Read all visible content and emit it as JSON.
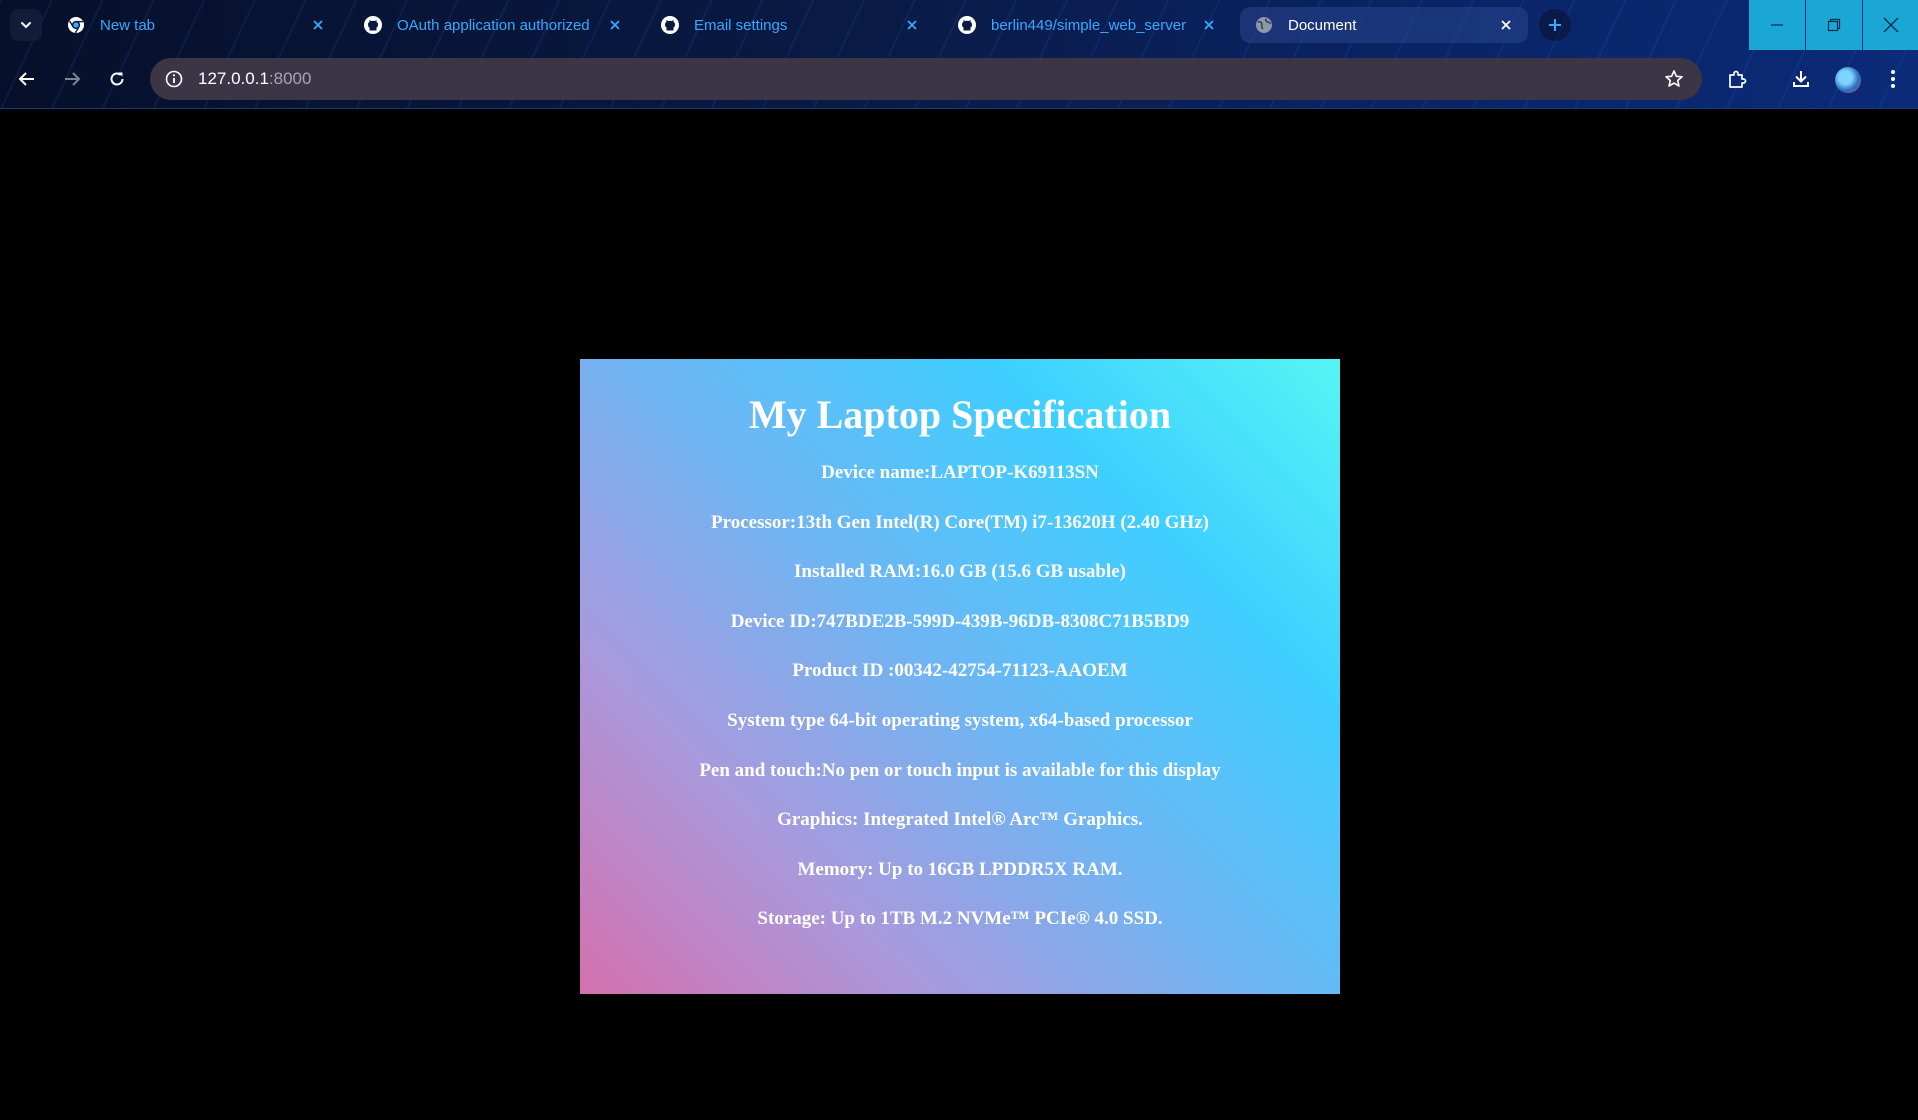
{
  "browser": {
    "tabs": [
      {
        "title": "New tab",
        "icon": "chrome-icon",
        "active": false
      },
      {
        "title": "OAuth application authorized",
        "icon": "github-icon",
        "active": false
      },
      {
        "title": "Email settings",
        "icon": "github-icon",
        "active": false
      },
      {
        "title": "berlin449/simple_web_server",
        "icon": "github-icon",
        "active": false
      },
      {
        "title": "Document",
        "icon": "globe-icon",
        "active": true
      }
    ],
    "address": {
      "host": "127.0.0.1",
      "port": ":8000"
    },
    "colors": {
      "accent": "#3aa8ff",
      "window_controls": "#1aa7d6",
      "omnibox": "#3b3546"
    }
  },
  "page": {
    "title": "My Laptop Specification",
    "specs": [
      "Device name:LAPTOP-K69113SN",
      "Processor:13th Gen Intel(R) Core(TM) i7-13620H (2.40 GHz)",
      "Installed RAM:16.0 GB (15.6 GB usable)",
      "Device ID:747BDE2B-599D-439B-96DB-8308C71B5BD9",
      "Product ID :00342-42754-71123-AAOEM",
      "System type 64-bit operating system, x64-based processor",
      "Pen and touch:No pen or touch input is available for this display",
      "Graphics: Integrated Intel® Arc™ Graphics.",
      "Memory: Up to 16GB LPDDR5X RAM.",
      "Storage: Up to 1TB M.2 NVMe™ PCIe® 4.0 SSD."
    ],
    "colors": {
      "gradient": [
        "#56f5f4",
        "#3ecfff",
        "#6cb6f4",
        "#a999dc",
        "#d470ae"
      ],
      "text": "#ffffff",
      "background": "#000000"
    }
  }
}
